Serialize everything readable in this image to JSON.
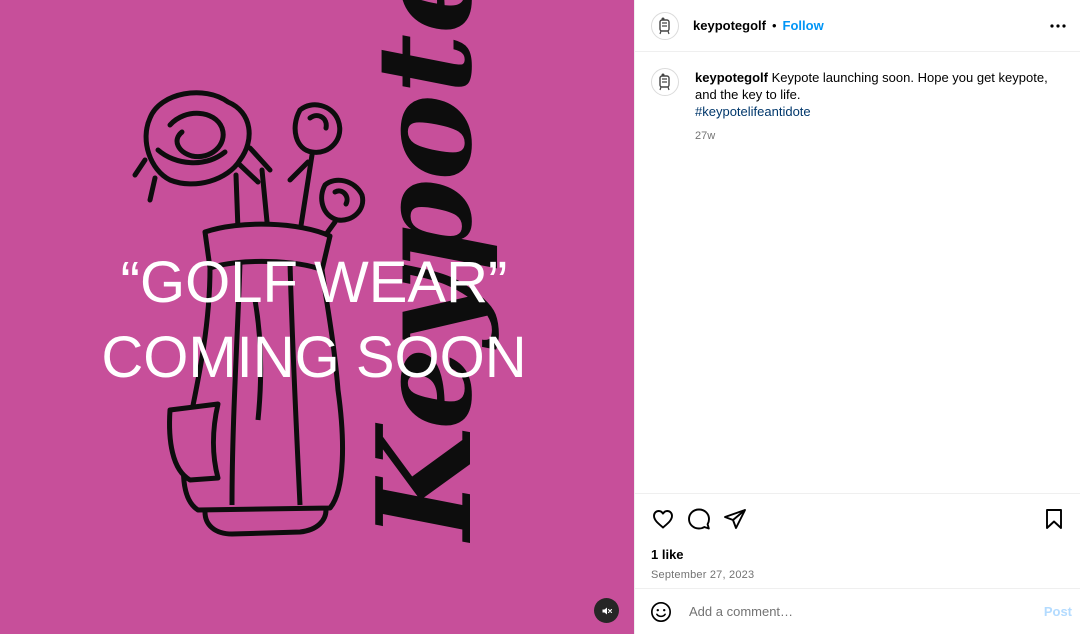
{
  "colors": {
    "media_background": "#c74f9a",
    "follow": "#0095f6",
    "hashtag": "#00376b",
    "post_disabled": "#b3dbff"
  },
  "media": {
    "headline_line1": "“GOLF WEAR”",
    "headline_line2": "COMING SOON",
    "brand_script": "Keypote.",
    "mute_icon": "speaker-muted-icon"
  },
  "header": {
    "username": "keypotegolf",
    "separator": "•",
    "follow_label": "Follow",
    "more_icon": "more-horizontal-icon"
  },
  "caption": {
    "username": "keypotegolf",
    "text": "Keypote launching soon. Hope you get keypote, and the key to life.",
    "hashtag": "#keypotelifeantidote",
    "time_ago": "27w"
  },
  "actions": {
    "like_icon": "heart-icon",
    "comment_icon": "comment-icon",
    "share_icon": "send-icon",
    "save_icon": "bookmark-icon",
    "likes": "1 like",
    "date": "September 27, 2023"
  },
  "comment_box": {
    "emoji_icon": "emoji-icon",
    "placeholder": "Add a comment…",
    "post_label": "Post"
  }
}
